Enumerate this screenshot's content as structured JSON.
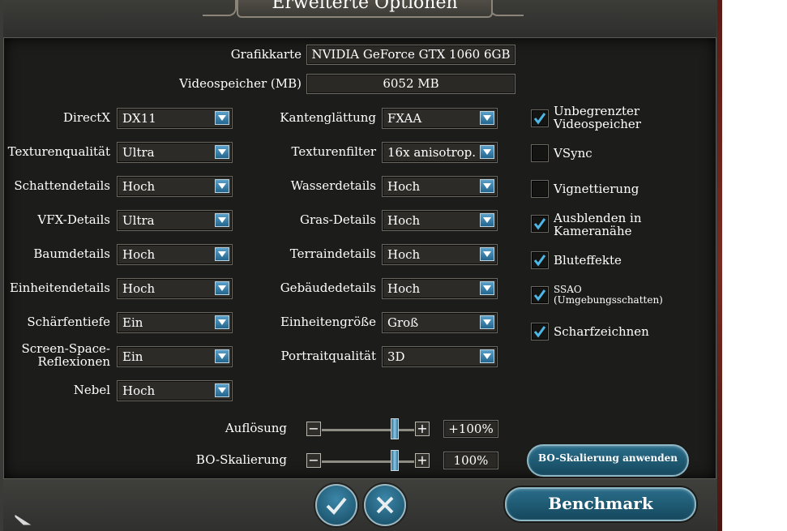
{
  "title": "Erweiterte Optionen",
  "gpu": {
    "label": "Grafikkarte",
    "value": "NVIDIA GeForce GTX 1060 6GB"
  },
  "vram": {
    "label": "Videospeicher (MB)",
    "value": "6052 MB"
  },
  "left_settings": [
    {
      "label": "DirectX",
      "value": "DX11"
    },
    {
      "label": "Texturenqualität",
      "value": "Ultra"
    },
    {
      "label": "Schattendetails",
      "value": "Hoch"
    },
    {
      "label": "VFX-Details",
      "value": "Ultra"
    },
    {
      "label": "Baumdetails",
      "value": "Hoch"
    },
    {
      "label": "Einheitendetails",
      "value": "Hoch"
    },
    {
      "label": "Schärfentiefe",
      "value": "Ein"
    },
    {
      "label_line1": "Screen-Space-",
      "label_line2": "Reflexionen",
      "value": "Ein"
    },
    {
      "label": "Nebel",
      "value": "Hoch"
    }
  ],
  "mid_settings": [
    {
      "label": "Kantenglättung",
      "value": "FXAA"
    },
    {
      "label": "Texturenfilter",
      "value": "16x anisotrop."
    },
    {
      "label": "Wasserdetails",
      "value": "Hoch"
    },
    {
      "label": "Gras-Details",
      "value": "Hoch"
    },
    {
      "label": "Terraindetails",
      "value": "Hoch"
    },
    {
      "label": "Gebäudedetails",
      "value": "Hoch"
    },
    {
      "label": "Einheitengröße",
      "value": "Groß"
    },
    {
      "label": "Portraitqualität",
      "value": "3D"
    }
  ],
  "checkboxes": [
    {
      "line1": "Unbegrenzter",
      "line2": "Videospeicher",
      "checked": true
    },
    {
      "line1": "VSync",
      "checked": false
    },
    {
      "line1": "Vignettierung",
      "checked": false
    },
    {
      "line1": "Ausblenden in",
      "line2": "Kameranähe",
      "checked": true
    },
    {
      "line1": "Bluteffekte",
      "checked": true
    },
    {
      "line1": "SSAO",
      "line2": "(Umgebungsschatten)",
      "checked": true
    },
    {
      "line1": "Scharfzeichnen",
      "checked": true
    }
  ],
  "sliders": {
    "resolution": {
      "label": "Auflösung",
      "value": "+100%",
      "level": 1.0
    },
    "bo_scaling": {
      "label": "BO-Skalierung",
      "value": "100%",
      "level": 1.0
    }
  },
  "buttons": {
    "apply_bo": "BO-Skalierung anwenden",
    "benchmark": "Benchmark"
  },
  "icons": {
    "confirm": "checkmark-icon",
    "cancel": "close-icon",
    "dropdown": "chevron-down-icon"
  },
  "colors": {
    "accent": "#2a6d8a",
    "panel": "#1c1c1b",
    "frame": "#3e3e3b",
    "check": "#4fb7e6"
  }
}
